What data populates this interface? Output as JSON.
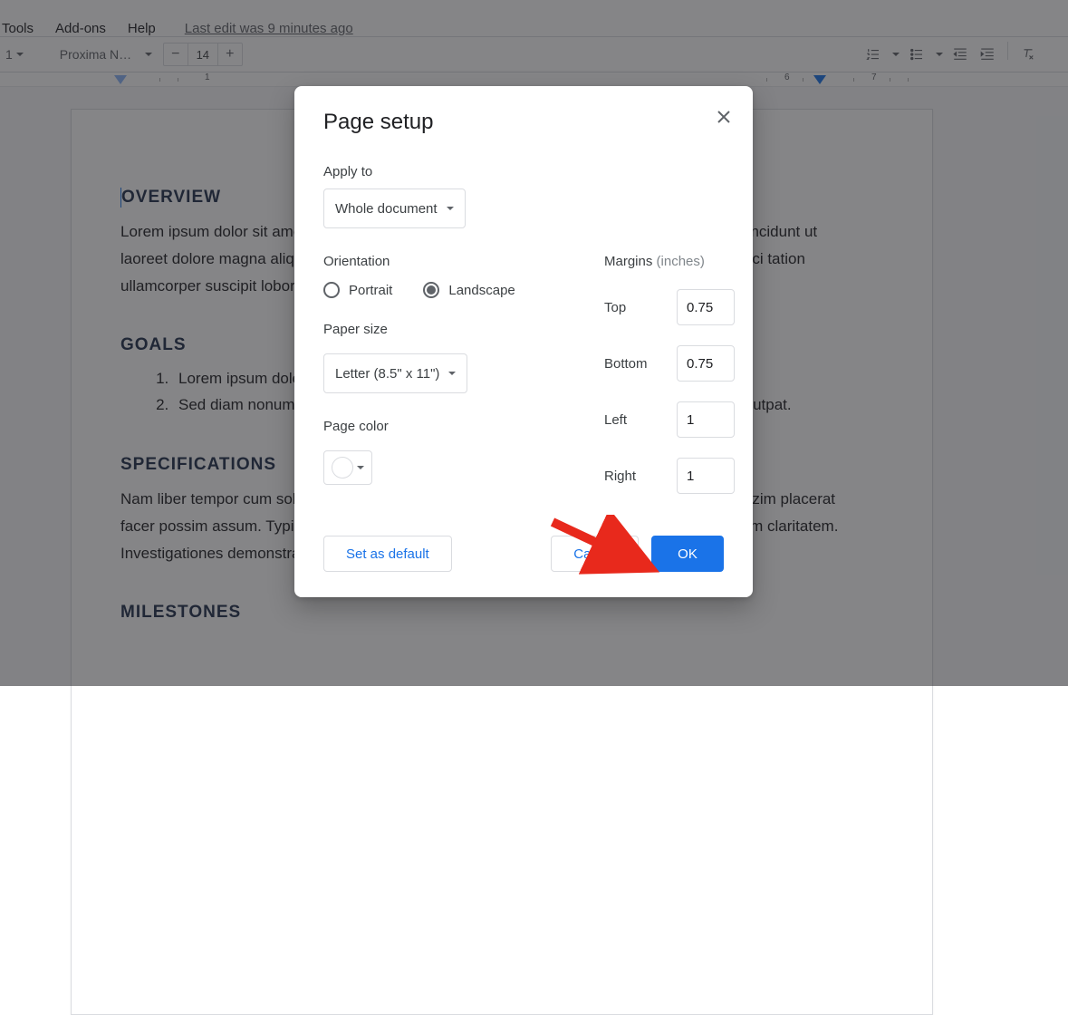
{
  "menubar": {
    "tools": "Tools",
    "addons": "Add-ons",
    "help": "Help",
    "last_edit": "Last edit was 9 minutes ago"
  },
  "toolbar": {
    "style_number": "1",
    "font_name": "Proxima N…",
    "font_size": "14"
  },
  "ruler": {
    "marks": [
      "1",
      "6",
      "7"
    ]
  },
  "doc": {
    "h_overview": "OVERVIEW",
    "p_overview": "Lorem ipsum dolor sit amet, consectetuer adipiscing elit, sed diam nonummy nibh euismod tincidunt ut laoreet dolore magna aliquam erat volutpat. Ut wisi enim ad minim veniam, quis nostrud exerci tation ullamcorper suscipit lobortis nisl ut aliquip ex ea commodo consequat.",
    "h_goals": "GOALS",
    "goals": [
      "Lorem ipsum dolor sit amet, consectetuer adipiscing elit, sed diam nonummy.",
      "Sed diam nonummy nibh euismod tincidunt ut laoreet dolore magna aliquam erat volutpat."
    ],
    "h_specs": "SPECIFICATIONS",
    "p_specs": "Nam liber tempor cum soluta nobis eleifend option congue nihil imperdiet doming id quod mazim placerat facer possim assum. Typi non habent claritatem insitam; est usus legentis in iis qui facit eorum claritatem. Investigationes demonstraverunt lectores legere me lius quod ii legunt saepius.",
    "h_milestones": "MILESTONES"
  },
  "dialog": {
    "title": "Page setup",
    "apply_to_label": "Apply to",
    "apply_to_value": "Whole document",
    "orientation_label": "Orientation",
    "orientation_portrait": "Portrait",
    "orientation_landscape": "Landscape",
    "orientation_selected": "landscape",
    "paper_size_label": "Paper size",
    "paper_size_value": "Letter (8.5\" x 11\")",
    "page_color_label": "Page color",
    "margins_label": "Margins",
    "margins_units": "(inches)",
    "margin_top_label": "Top",
    "margin_top_value": "0.75",
    "margin_bottom_label": "Bottom",
    "margin_bottom_value": "0.75",
    "margin_left_label": "Left",
    "margin_left_value": "1",
    "margin_right_label": "Right",
    "margin_right_value": "1",
    "set_default": "Set as default",
    "cancel": "Cancel",
    "ok": "OK"
  }
}
